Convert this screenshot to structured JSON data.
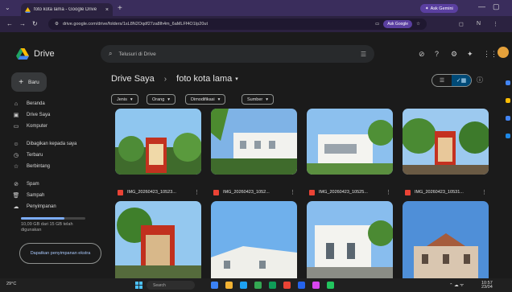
{
  "browser": {
    "tab_title": "foto kota lama - Google Drive",
    "tab_close": "×",
    "new_tab": "+",
    "gemini_label": "Ask Gemini",
    "url": "drive.google.com/drive/folders/1sL8N2Oqdf27za8lh4m_6aMLFf4O1Ip20ut",
    "ask_google_label": "Ask Google",
    "window_controls": [
      "—",
      "▢"
    ]
  },
  "drive": {
    "logo_text": "Drive",
    "search_placeholder": "Telusuri di Drive",
    "new_button_label": "Baru",
    "nav": [
      {
        "icon": "home-icon",
        "label": "Beranda"
      },
      {
        "icon": "my-drive-icon",
        "label": "Drive Saya"
      },
      {
        "icon": "computer-icon",
        "label": "Komputer"
      },
      {
        "icon": "shared-icon",
        "label": "Dibagikan kepada saya"
      },
      {
        "icon": "clock-icon",
        "label": "Terbaru"
      },
      {
        "icon": "star-icon",
        "label": "Berbintang"
      },
      {
        "icon": "spam-icon",
        "label": "Spam"
      },
      {
        "icon": "trash-icon",
        "label": "Sampah"
      },
      {
        "icon": "cloud-icon",
        "label": "Penyimpanan"
      }
    ],
    "storage": {
      "used_fraction": 0.67,
      "text": "10,09 GB dari 15 GB telah digunakan"
    },
    "get_storage_label": "Dapatkan penyimpanan ekstra",
    "breadcrumb": {
      "parent": "Drive Saya",
      "separator": "›",
      "current": "foto kota lama",
      "dropdown": "▾"
    },
    "filters": [
      "Jenis",
      "Orang",
      "Dimodifikasi",
      "Sumber"
    ],
    "files_row2": [
      "IMG_20260423_10523...",
      "IMG_20260423_1052...",
      "IMG_20260423_10525...",
      "IMG_20260423_10531..."
    ],
    "more_glyph": "⋮"
  },
  "taskbar": {
    "weather": "29°C",
    "search_label": "Search",
    "tray_time": "10:57",
    "tray_date": "23/04"
  },
  "colors": {
    "accent_blue": "#a8c7fa",
    "selected_bg": "#004a77",
    "pdf_red": "#ea4335",
    "chrome_purple": "#3a2d5c"
  }
}
